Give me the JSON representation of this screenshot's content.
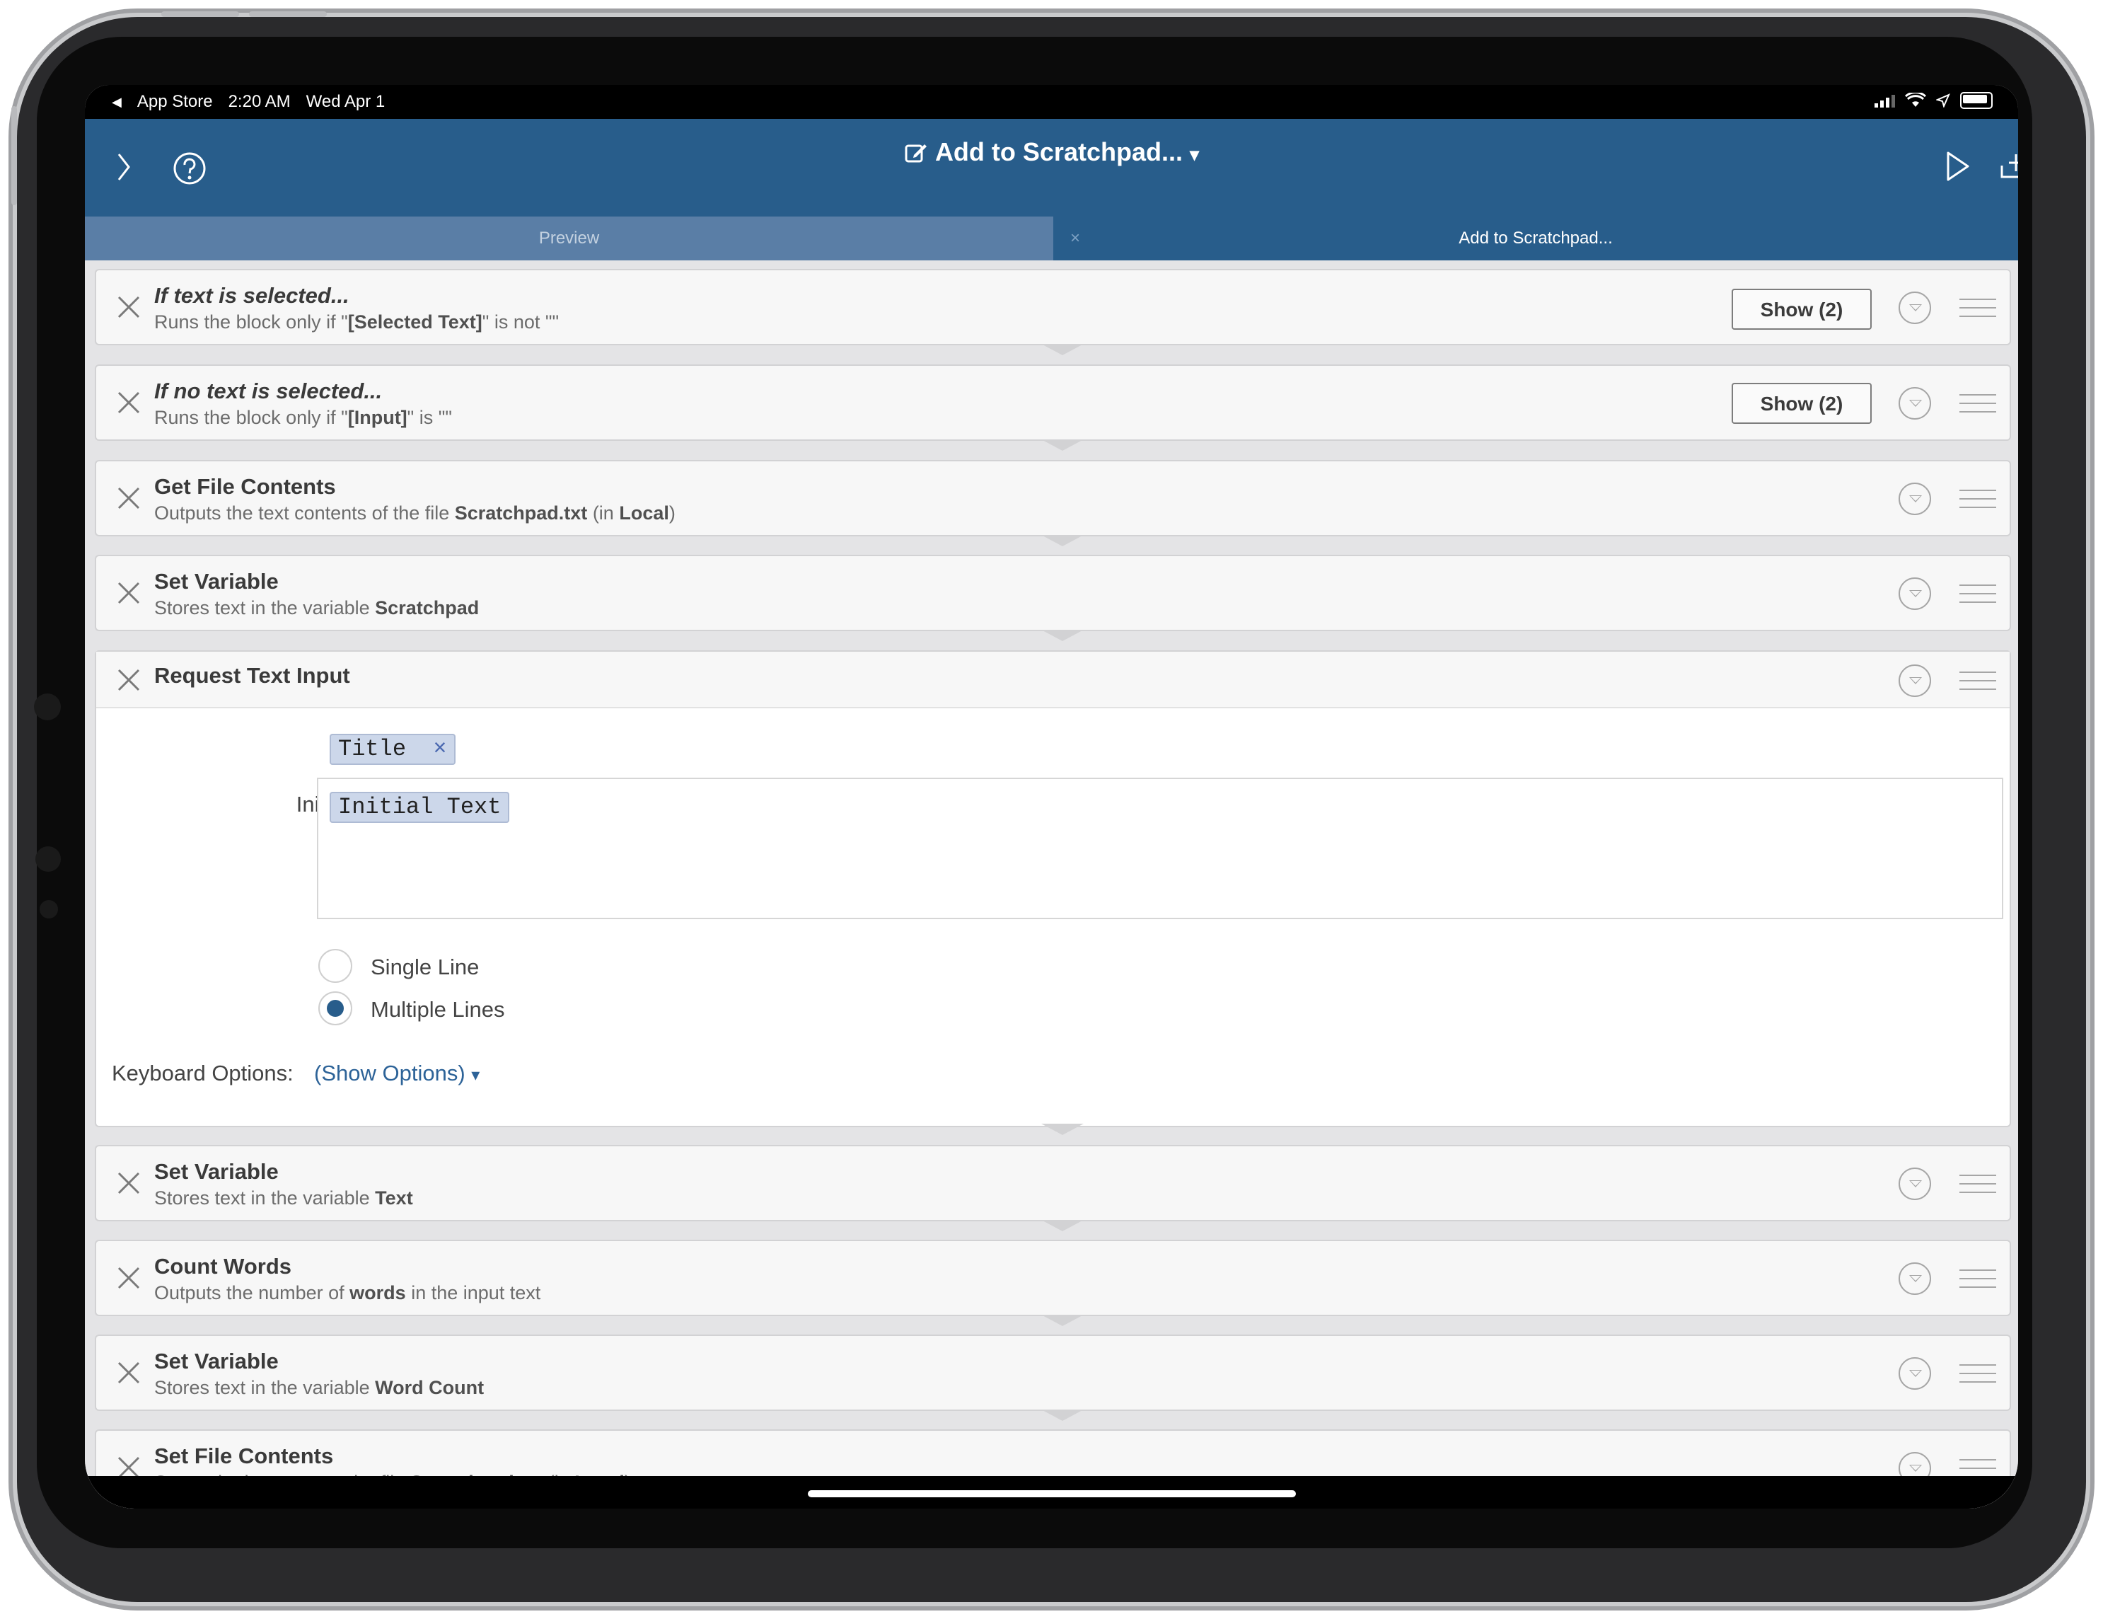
{
  "status_bar": {
    "back_app": "App Store",
    "time": "2:20 AM",
    "date": "Wed Apr 1"
  },
  "nav": {
    "title": "Add to Scratchpad...",
    "title_caret": "▾"
  },
  "tabs": {
    "preview": "Preview",
    "current": "Add to Scratchpad...",
    "close_glyph": "×"
  },
  "blocks": [
    {
      "title": "If text is selected...",
      "italic": true,
      "sub_pre": "Runs the block only if \"",
      "sub_bold": "[Selected Text]",
      "sub_post": "\" is not \"\"",
      "show": "Show (2)"
    },
    {
      "title": "If no text is selected...",
      "italic": true,
      "sub_pre": "Runs the block only if \"",
      "sub_bold": "[Input]",
      "sub_post": "\" is \"\"",
      "show": "Show (2)"
    },
    {
      "title": "Get File Contents",
      "sub_pre": "Outputs the text contents of the file ",
      "sub_bold": "Scratchpad.txt",
      "sub_post": " (in ",
      "sub_bold2": "Local",
      "sub_post2": ")"
    },
    {
      "title": "Set Variable",
      "sub_pre": "Stores text in the variable ",
      "sub_bold": "Scratchpad"
    },
    {
      "title": "Request Text Input"
    },
    {
      "title": "Set Variable",
      "sub_pre": "Stores text in the variable ",
      "sub_bold": "Text"
    },
    {
      "title": "Count Words",
      "sub_pre": "Outputs the number of ",
      "sub_bold": "words",
      "sub_post": " in the input text"
    },
    {
      "title": "Set Variable",
      "sub_pre": "Stores text in the variable ",
      "sub_bold": "Word Count"
    },
    {
      "title": "Set File Contents",
      "sub_pre": "Saves the input text to the file ",
      "sub_bold": "Scratchpad.txt",
      "sub_post": " (in ",
      "sub_bold2": "Local",
      "sub_post2": ")"
    }
  ],
  "request_form": {
    "title_label": "Title",
    "title_token": "Title",
    "token_remove": "×",
    "initial_label": "Initial Text",
    "initial_token": "Initial Text",
    "option_single": "Single Line",
    "option_multi": "Multiple Lines",
    "selected_option": "Multiple Lines",
    "keyboard_label": "Keyboard Options:",
    "keyboard_link": "(Show Options)",
    "keyboard_caret": "▾"
  },
  "colors": {
    "accent": "#285d8b",
    "tab_inactive": "#5a7ea6",
    "link": "#2d6398"
  },
  "icons": {
    "sidebar": "chevron-right-icon",
    "help": "question-circle-icon",
    "edit": "edit-square-icon",
    "run": "play-icon",
    "add": "tray-add-icon",
    "delete": "close-x-icon",
    "options": "chevron-down-circle-icon",
    "reorder": "drag-handle-icon"
  }
}
